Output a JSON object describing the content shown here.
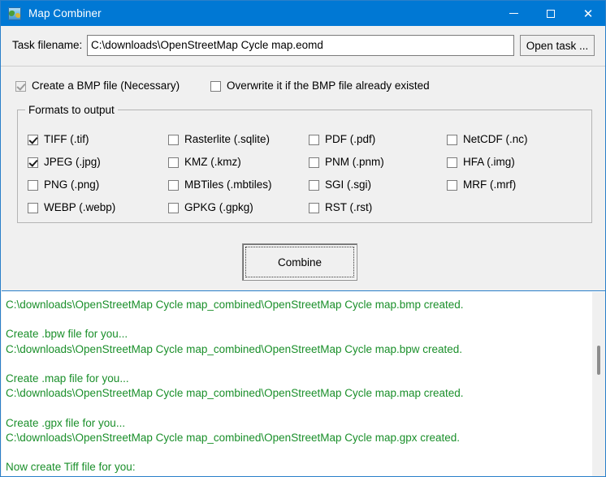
{
  "window": {
    "title": "Map Combiner",
    "icon": "globe-map-icon",
    "accent_color": "#0078d4",
    "controls": {
      "minimize": "–",
      "maximize": "□",
      "close": "✕"
    }
  },
  "task": {
    "label": "Task filename:",
    "filename_value": "C:\\downloads\\OpenStreetMap Cycle map.eomd",
    "filename_placeholder": "",
    "open_button": "Open task ..."
  },
  "options": {
    "create_bmp": {
      "label": "Create a  BMP file (Necessary)",
      "checked": true,
      "disabled": true
    },
    "overwrite_bmp": {
      "label": "Overwrite it if the BMP file already existed",
      "checked": false,
      "disabled": false
    }
  },
  "formats": {
    "group_title": "Formats to output",
    "columns": [
      {
        "items": [
          {
            "label": "TIFF (.tif)",
            "checked": true
          },
          {
            "label": "JPEG (.jpg)",
            "checked": true
          },
          {
            "label": "PNG (.png)",
            "checked": false
          },
          {
            "label": "WEBP (.webp)",
            "checked": false
          }
        ]
      },
      {
        "items": [
          {
            "label": "Rasterlite (.sqlite)",
            "checked": false
          },
          {
            "label": "KMZ (.kmz)",
            "checked": false
          },
          {
            "label": "MBTiles (.mbtiles)",
            "checked": false
          },
          {
            "label": "GPKG (.gpkg)",
            "checked": false
          }
        ]
      },
      {
        "items": [
          {
            "label": "PDF (.pdf)",
            "checked": false
          },
          {
            "label": "PNM (.pnm)",
            "checked": false
          },
          {
            "label": "SGI (.sgi)",
            "checked": false
          },
          {
            "label": "RST (.rst)",
            "checked": false
          }
        ]
      },
      {
        "items": [
          {
            "label": "NetCDF (.nc)",
            "checked": false
          },
          {
            "label": "HFA (.img)",
            "checked": false
          },
          {
            "label": "MRF (.mrf)",
            "checked": false
          }
        ]
      }
    ]
  },
  "actions": {
    "combine": "Combine"
  },
  "log": {
    "text_color": "#1a8f2a",
    "lines": [
      "C:\\downloads\\OpenStreetMap Cycle map_combined\\OpenStreetMap Cycle map.bmp created.",
      "",
      "Create .bpw file for you...",
      "C:\\downloads\\OpenStreetMap Cycle map_combined\\OpenStreetMap Cycle map.bpw created.",
      "",
      "Create .map file for you...",
      "C:\\downloads\\OpenStreetMap Cycle map_combined\\OpenStreetMap Cycle map.map created.",
      "",
      "Create .gpx file for you...",
      "C:\\downloads\\OpenStreetMap Cycle map_combined\\OpenStreetMap Cycle map.gpx created.",
      "",
      "Now create Tiff file for you:"
    ]
  }
}
